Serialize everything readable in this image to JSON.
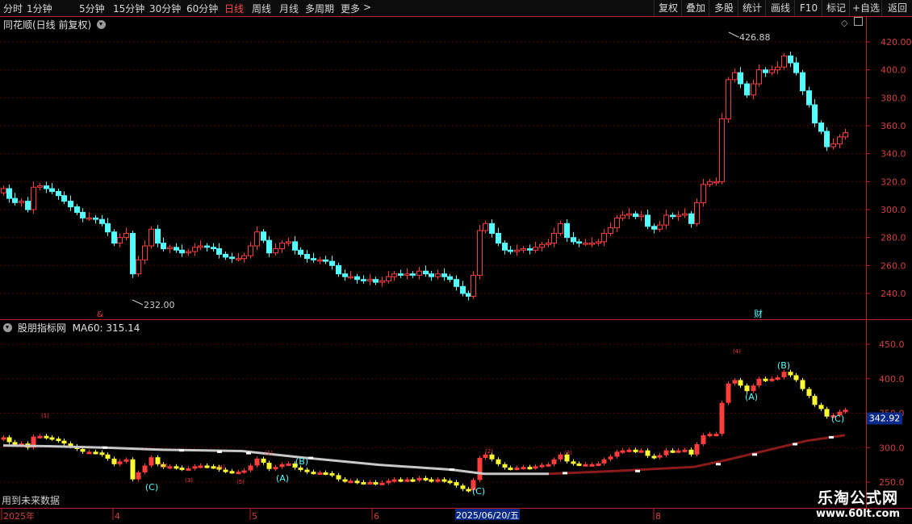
{
  "toolbar": {
    "periods": [
      {
        "label": "分时",
        "x": 4
      },
      {
        "label": "1分钟",
        "x": 33
      },
      {
        "label": "5分钟",
        "x": 98
      },
      {
        "label": "15分钟",
        "x": 140
      },
      {
        "label": "30分钟",
        "x": 185
      },
      {
        "label": "60分钟",
        "x": 231
      },
      {
        "label": "日线",
        "x": 278,
        "active": true
      },
      {
        "label": "周线",
        "x": 312
      },
      {
        "label": "月线",
        "x": 346
      },
      {
        "label": "多周期",
        "x": 378
      },
      {
        "label": "更多",
        "x": 422
      }
    ],
    "more_arrow": ">",
    "right_buttons": [
      {
        "label": "复权",
        "x": 810,
        "w": 34
      },
      {
        "label": "叠加",
        "x": 844,
        "w": 34
      },
      {
        "label": "多股",
        "x": 878,
        "w": 36
      },
      {
        "label": "统计",
        "x": 914,
        "w": 34
      },
      {
        "label": "画线",
        "x": 948,
        "w": 36
      },
      {
        "label": "F10",
        "x": 984,
        "w": 34
      },
      {
        "label": "标记",
        "x": 1018,
        "w": 34
      },
      {
        "label": "+自选",
        "x": 1052,
        "w": 40
      },
      {
        "label": "返回",
        "x": 1092,
        "w": 38
      }
    ]
  },
  "main_panel": {
    "title": "同花顺(日线 前复权)",
    "y_ticks": [
      "420.00",
      "400.0",
      "380.0",
      "360.0",
      "340.0",
      "320.0",
      "300.0",
      "280.0",
      "260.0",
      "240.0"
    ],
    "high_label": "426.88",
    "low_label": "232.00",
    "marker_fin": "财",
    "marker_left": "&"
  },
  "indicator_panel": {
    "title": "股朋指标网",
    "ma_label": "MA60: 315.14",
    "y_ticks": [
      "450.0",
      "400.0",
      "350.0",
      "300.0",
      "250.0"
    ],
    "current_value": "342.92",
    "footer_note": "用到未来数据",
    "wave_labels": [
      "(C)",
      "(A)",
      "(B)",
      "(C)",
      "(A)",
      "(B)",
      "(C)"
    ]
  },
  "date_axis": {
    "labels": [
      {
        "text": "2025年",
        "x": 4
      },
      {
        "text": "4",
        "x": 142
      },
      {
        "text": "5",
        "x": 312
      },
      {
        "text": "6",
        "x": 463
      },
      {
        "text": "8",
        "x": 812
      }
    ],
    "cursor_label": "2025/06/20/五"
  },
  "watermark": {
    "title": "乐淘公式网",
    "url": "www.60lt.com"
  },
  "colors": {
    "up": "#ff3d3d",
    "down": "#54ffff",
    "grid": "#5a0000",
    "axis": "#c02020",
    "yellow": "#ffff33",
    "ma_gray": "#c8c8c8",
    "ma_red": "#8b1a1a"
  }
}
